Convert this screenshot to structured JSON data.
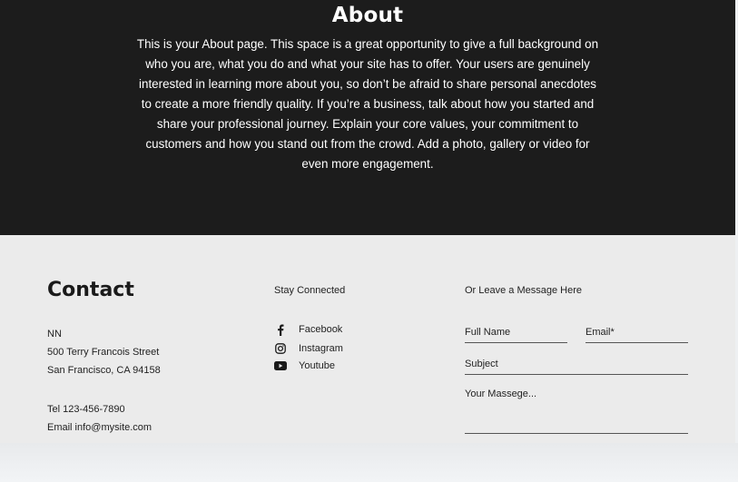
{
  "about": {
    "title": "About",
    "body": "This is your About page. This space is a great opportunity to give a full background on who you are, what you do and what your site has to offer. Your users are genuinely interested in learning more about you, so don’t be afraid to share personal anecdotes to create a more friendly quality. If you’re a business, talk about how you started and share your professional journey. Explain your core values, your commitment to customers and how you stand out from the crowd. Add a photo, gallery or video for even more engagement."
  },
  "contact": {
    "title": "Contact",
    "name": "NN",
    "street": "500 Terry Francois Street",
    "city": "San Francisco, CA 94158",
    "tel": "Tel 123-456-7890",
    "email": "Email info@mysite.com"
  },
  "social": {
    "heading": "Stay Connected",
    "items": [
      {
        "label": "Facebook",
        "icon": "facebook-icon"
      },
      {
        "label": "Instagram",
        "icon": "instagram-icon"
      },
      {
        "label": "Youtube",
        "icon": "youtube-icon"
      }
    ]
  },
  "form": {
    "heading": "Or Leave a Message Here",
    "full_name": "Full Name",
    "email": "Email*",
    "subject": "Subject",
    "message": "Your Massege..."
  },
  "colors": {
    "about_bg": "#1c1c1c",
    "contact_bg": "#ebebeb"
  }
}
